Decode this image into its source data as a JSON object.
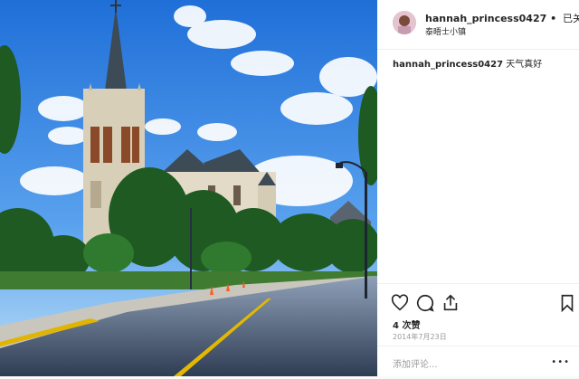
{
  "post": {
    "username": "hannah_princess0427",
    "separator": "•",
    "follow_status": "已关注",
    "location": "泰晤士小镇",
    "caption_user": "hannah_princess0427",
    "caption_text": "天气真好",
    "likes": "4 次赞",
    "date": "2014年7月23日",
    "comment_placeholder": "添加评论...",
    "more": "•••"
  },
  "icons": {
    "like": "heart-icon",
    "comment": "comment-icon",
    "share": "share-icon",
    "save": "bookmark-icon"
  }
}
